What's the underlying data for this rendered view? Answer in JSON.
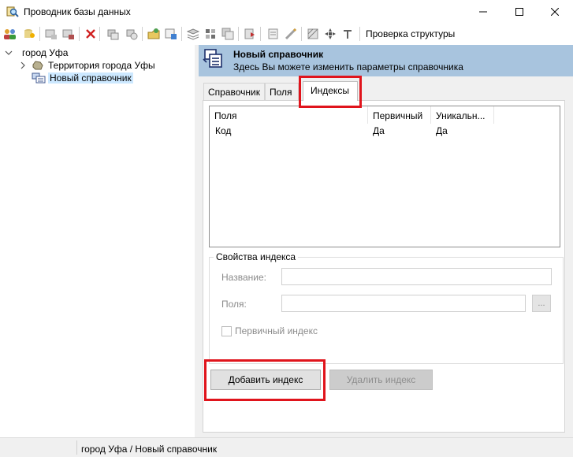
{
  "window": {
    "title": "Проводник базы данных"
  },
  "toolbar": {
    "check_structure_label": "Проверка структуры"
  },
  "tree": {
    "root": "город Уфа",
    "items": [
      {
        "label": "Территория города Уфы"
      },
      {
        "label": "Новый справочник",
        "selected": true
      }
    ]
  },
  "header": {
    "title": "Новый справочник",
    "subtitle": "Здесь Вы можете изменить параметры справочника"
  },
  "tabs": [
    {
      "label": "Справочник"
    },
    {
      "label": "Поля"
    },
    {
      "label": "Индексы",
      "active": true
    }
  ],
  "indexes_table": {
    "columns": [
      "Поля",
      "Первичный",
      "Уникальн..."
    ],
    "rows": [
      [
        "Код",
        "Да",
        "Да"
      ]
    ]
  },
  "index_props": {
    "legend": "Свойства индекса",
    "name_label": "Название:",
    "name_value": "",
    "fields_label": "Поля:",
    "fields_value": "",
    "browse_label": "...",
    "primary_label": "Первичный индекс"
  },
  "buttons": {
    "add_index": "Добавить индекс",
    "delete_index": "Удалить индекс"
  },
  "status": {
    "path": "город Уфа / Новый справочник"
  },
  "colors": {
    "header_bg": "#a8c4de",
    "highlight_red": "#e0141c",
    "selection_bg": "#cce8ff"
  }
}
